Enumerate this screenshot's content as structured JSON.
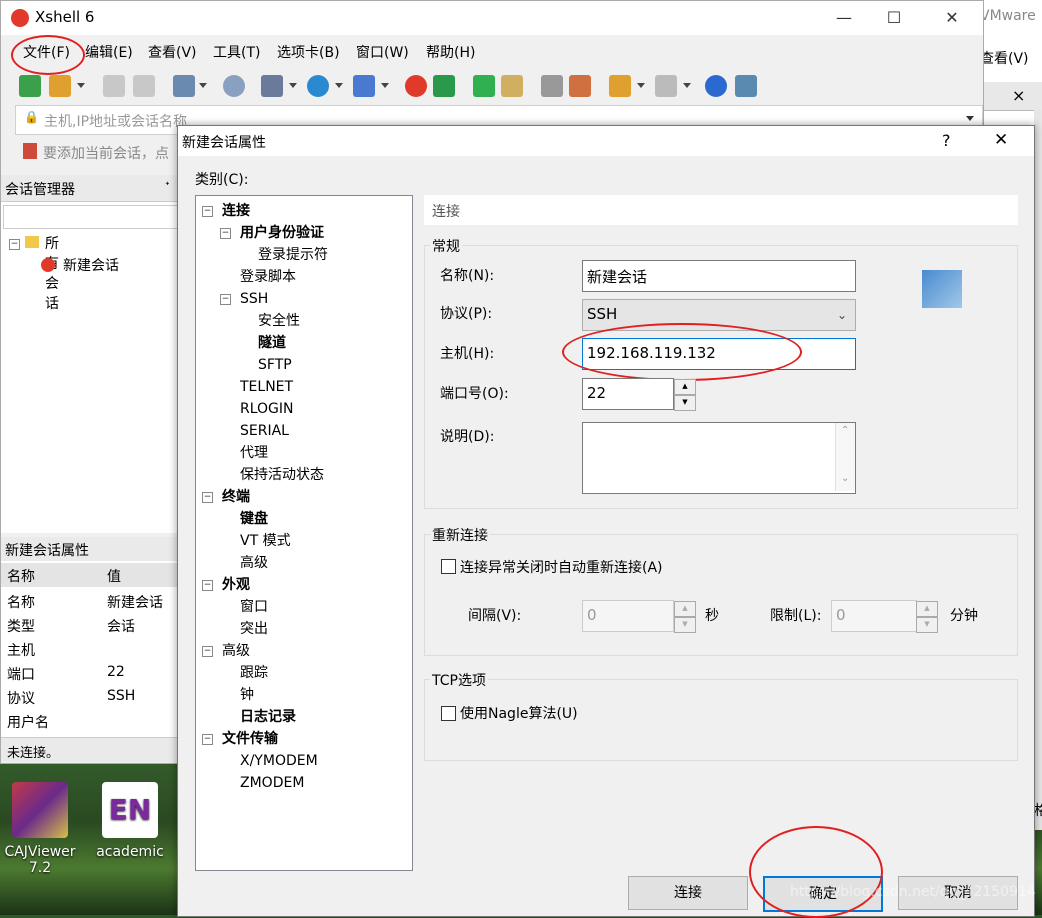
{
  "xshell": {
    "title": "Xshell 6",
    "menu": [
      "文件(F)",
      "编辑(E)",
      "查看(V)",
      "工具(T)",
      "选项卡(B)",
      "窗口(W)",
      "帮助(H)"
    ],
    "address_placeholder": "主机,IP地址或会话名称",
    "add_session_hint": "要添加当前会话，点",
    "session_manager_title": "会话管理器",
    "tree": {
      "root": "所有会话",
      "child": "新建会话"
    },
    "props_title": "新建会话属性",
    "props_header": {
      "name": "名称",
      "value": "值"
    },
    "props_rows": [
      {
        "name": "名称",
        "value": "新建会话"
      },
      {
        "name": "类型",
        "value": "会话"
      },
      {
        "name": "主机",
        "value": ""
      },
      {
        "name": "端口",
        "value": "22"
      },
      {
        "name": "协议",
        "value": "SSH"
      },
      {
        "name": "用户名",
        "value": ""
      }
    ],
    "status": "未连接。"
  },
  "vmware": {
    "title_fragment": "VMware",
    "menu_fragment": "查看(V)",
    "close": "×",
    "side_fragment": "格"
  },
  "desktop": {
    "icons": [
      {
        "label_line1": "CAJViewer",
        "label_line2": "7.2"
      },
      {
        "label_line1": "academic",
        "label_line2": "",
        "glyph": "EN"
      }
    ]
  },
  "dialog": {
    "title": "新建会话属性",
    "help": "?",
    "close": "✕",
    "category_label": "类别(C):",
    "tree": [
      {
        "label": "连接",
        "level": 0,
        "bold": true,
        "box": "−"
      },
      {
        "label": "用户身份验证",
        "level": 1,
        "bold": true,
        "box": "−"
      },
      {
        "label": "登录提示符",
        "level": 2,
        "bold": false
      },
      {
        "label": "登录脚本",
        "level": 1,
        "bold": false
      },
      {
        "label": "SSH",
        "level": 1,
        "bold": false,
        "box": "−"
      },
      {
        "label": "安全性",
        "level": 2,
        "bold": false
      },
      {
        "label": "隧道",
        "level": 2,
        "bold": true
      },
      {
        "label": "SFTP",
        "level": 2,
        "bold": false
      },
      {
        "label": "TELNET",
        "level": 1,
        "bold": false
      },
      {
        "label": "RLOGIN",
        "level": 1,
        "bold": false
      },
      {
        "label": "SERIAL",
        "level": 1,
        "bold": false
      },
      {
        "label": "代理",
        "level": 1,
        "bold": false
      },
      {
        "label": "保持活动状态",
        "level": 1,
        "bold": false
      },
      {
        "label": "终端",
        "level": 0,
        "bold": true,
        "box": "−"
      },
      {
        "label": "键盘",
        "level": 1,
        "bold": true
      },
      {
        "label": "VT 模式",
        "level": 1,
        "bold": false
      },
      {
        "label": "高级",
        "level": 1,
        "bold": false
      },
      {
        "label": "外观",
        "level": 0,
        "bold": true,
        "box": "−"
      },
      {
        "label": "窗口",
        "level": 1,
        "bold": false
      },
      {
        "label": "突出",
        "level": 1,
        "bold": false
      },
      {
        "label": "高级",
        "level": 0,
        "bold": false,
        "box": "−"
      },
      {
        "label": "跟踪",
        "level": 1,
        "bold": false
      },
      {
        "label": "钟",
        "level": 1,
        "bold": false
      },
      {
        "label": "日志记录",
        "level": 1,
        "bold": true
      },
      {
        "label": "文件传输",
        "level": 0,
        "bold": true,
        "box": "−"
      },
      {
        "label": "X/YMODEM",
        "level": 1,
        "bold": false
      },
      {
        "label": "ZMODEM",
        "level": 1,
        "bold": false
      }
    ],
    "content_title": "连接",
    "general": {
      "legend": "常规",
      "name_label": "名称(N):",
      "name_value": "新建会话",
      "protocol_label": "协议(P):",
      "protocol_value": "SSH",
      "host_label": "主机(H):",
      "host_value": "192.168.119.132",
      "port_label": "端口号(O):",
      "port_value": "22",
      "desc_label": "说明(D):",
      "desc_value": ""
    },
    "reconnect": {
      "legend": "重新连接",
      "checkbox_label": "连接异常关闭时自动重新连接(A)",
      "interval_label": "间隔(V):",
      "interval_value": "0",
      "interval_unit": "秒",
      "limit_label": "限制(L):",
      "limit_value": "0",
      "limit_unit": "分钟"
    },
    "tcp": {
      "legend": "TCP选项",
      "checkbox_label": "使用Nagle算法(U)"
    },
    "buttons": {
      "connect": "连接",
      "ok": "确定",
      "cancel": "取消"
    },
    "watermark": "https://blog.csdn.net/qq_42150914"
  },
  "colors": {
    "annotation_red": "#e02020",
    "accent_blue": "#0078d7"
  }
}
